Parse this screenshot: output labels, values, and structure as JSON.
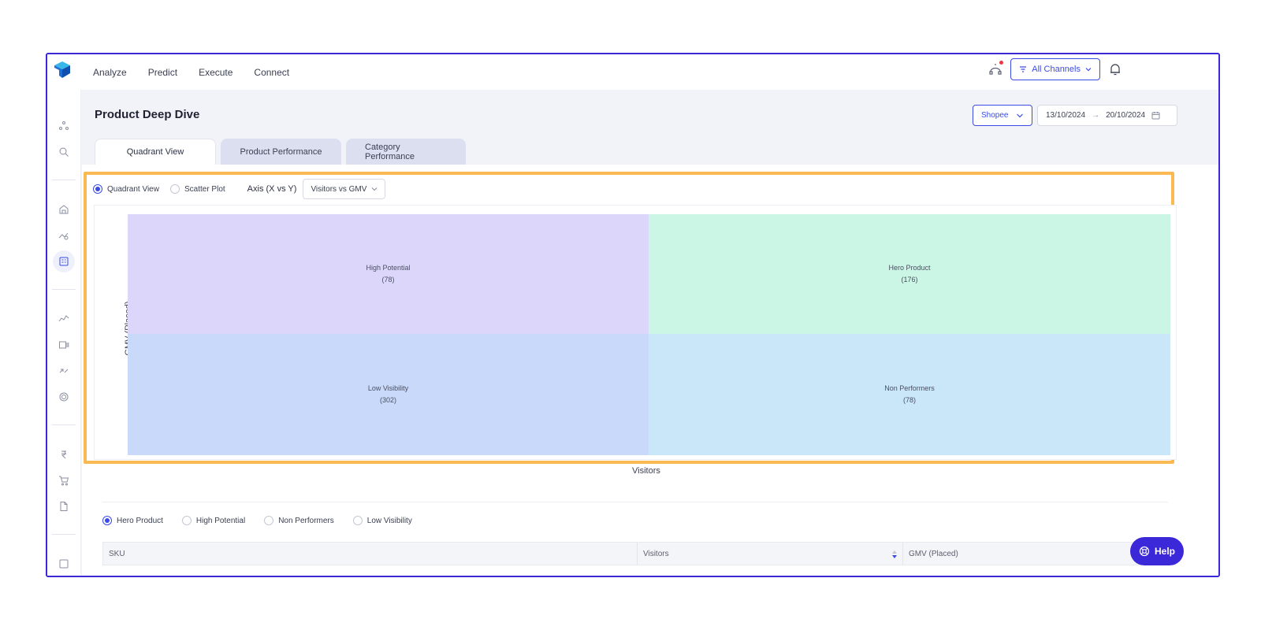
{
  "nav": {
    "items": [
      "Analyze",
      "Predict",
      "Execute",
      "Connect"
    ],
    "channels_label": "All Channels"
  },
  "page": {
    "title": "Product Deep Dive",
    "marketplace": "Shopee",
    "date_from": "13/10/2024",
    "date_arrow": "→",
    "date_to": "20/10/2024"
  },
  "tabs": [
    {
      "label": "Quadrant View",
      "active": true
    },
    {
      "label": "Product Performance",
      "active": false
    },
    {
      "label": "Category Performance",
      "active": false
    }
  ],
  "view_toggle": {
    "quadrant_label": "Quadrant View",
    "scatter_label": "Scatter Plot",
    "selected": "Quadrant View",
    "axis_label": "Axis (X vs Y)",
    "axis_value": "Visitors vs GMV"
  },
  "quadrants": [
    {
      "name": "High Potential",
      "count": "(78)",
      "color": "#dcd6fb"
    },
    {
      "name": "Hero Product",
      "count": "(176)",
      "color": "#cbf5e4"
    },
    {
      "name": "Low Visibility",
      "count": "(302)",
      "color": "#c9d9fa"
    },
    {
      "name": "Non Performers",
      "count": "(78)",
      "color": "#c9e7f8"
    }
  ],
  "axes": {
    "y_label": "GMV (Placed)",
    "x_label": "Visitors"
  },
  "filters": {
    "options": [
      "Hero Product",
      "High Potential",
      "Non Performers",
      "Low Visibility"
    ],
    "selected": "Hero Product"
  },
  "table": {
    "columns": [
      "SKU",
      "Visitors",
      "GMV (Placed)"
    ]
  },
  "help_label": "Help",
  "colors": {
    "accent": "#3b4be6",
    "frame": "#3b28d9",
    "highlight": "#fbb954"
  }
}
